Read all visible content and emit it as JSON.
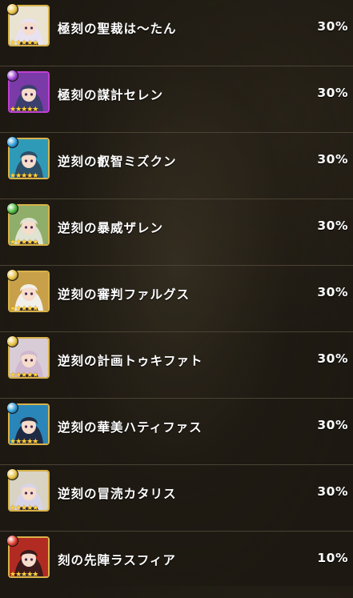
{
  "units": [
    {
      "name": "極刻の聖裁は〜たん",
      "rate": "30%",
      "element_color": "#e8c040",
      "frame_color": "#d8b24a",
      "bg": "#e9e3cf",
      "hair": "#e8e2f0",
      "icon": "unit-portrait-icon"
    },
    {
      "name": "極刻の謀計セレン",
      "rate": "30%",
      "element_color": "#9b3fd0",
      "frame_color": "#c040d0",
      "bg": "#7a3aa8",
      "hair": "#3a3f6e",
      "icon": "unit-portrait-icon"
    },
    {
      "name": "逆刻の叡智ミズクン",
      "rate": "30%",
      "element_color": "#2a9ad8",
      "frame_color": "#d8b24a",
      "bg": "#2f9ab8",
      "hair": "#2c4f6a",
      "icon": "unit-portrait-icon"
    },
    {
      "name": "逆刻の暴威ザレン",
      "rate": "30%",
      "element_color": "#4ab83a",
      "frame_color": "#d8b24a",
      "bg": "#8fae6a",
      "hair": "#dfe3d2",
      "icon": "unit-portrait-icon"
    },
    {
      "name": "逆刻の審判ファルグス",
      "rate": "30%",
      "element_color": "#e8c040",
      "frame_color": "#d8b24a",
      "bg": "#c9a04a",
      "hair": "#f2f0ea",
      "icon": "unit-portrait-icon"
    },
    {
      "name": "逆刻の計画トゥキファト",
      "rate": "30%",
      "element_color": "#e8c040",
      "frame_color": "#d8b24a",
      "bg": "#d8ccd6",
      "hair": "#cfb7d0",
      "icon": "unit-portrait-icon"
    },
    {
      "name": "逆刻の華美ハティファス",
      "rate": "30%",
      "element_color": "#2a9ad8",
      "frame_color": "#d8b24a",
      "bg": "#2a86b8",
      "hair": "#1f2b44",
      "icon": "unit-portrait-icon"
    },
    {
      "name": "逆刻の冒涜カタリス",
      "rate": "30%",
      "element_color": "#e8c040",
      "frame_color": "#d8b24a",
      "bg": "#d9d3c4",
      "hair": "#d8d4e8",
      "icon": "unit-portrait-icon"
    },
    {
      "name": "刻の先陣ラスフィア",
      "rate": "10%",
      "element_color": "#e03a2a",
      "frame_color": "#d8b24a",
      "bg": "#b22b22",
      "hair": "#3a1a1a",
      "icon": "unit-portrait-icon"
    }
  ],
  "stars": "★★★★★"
}
